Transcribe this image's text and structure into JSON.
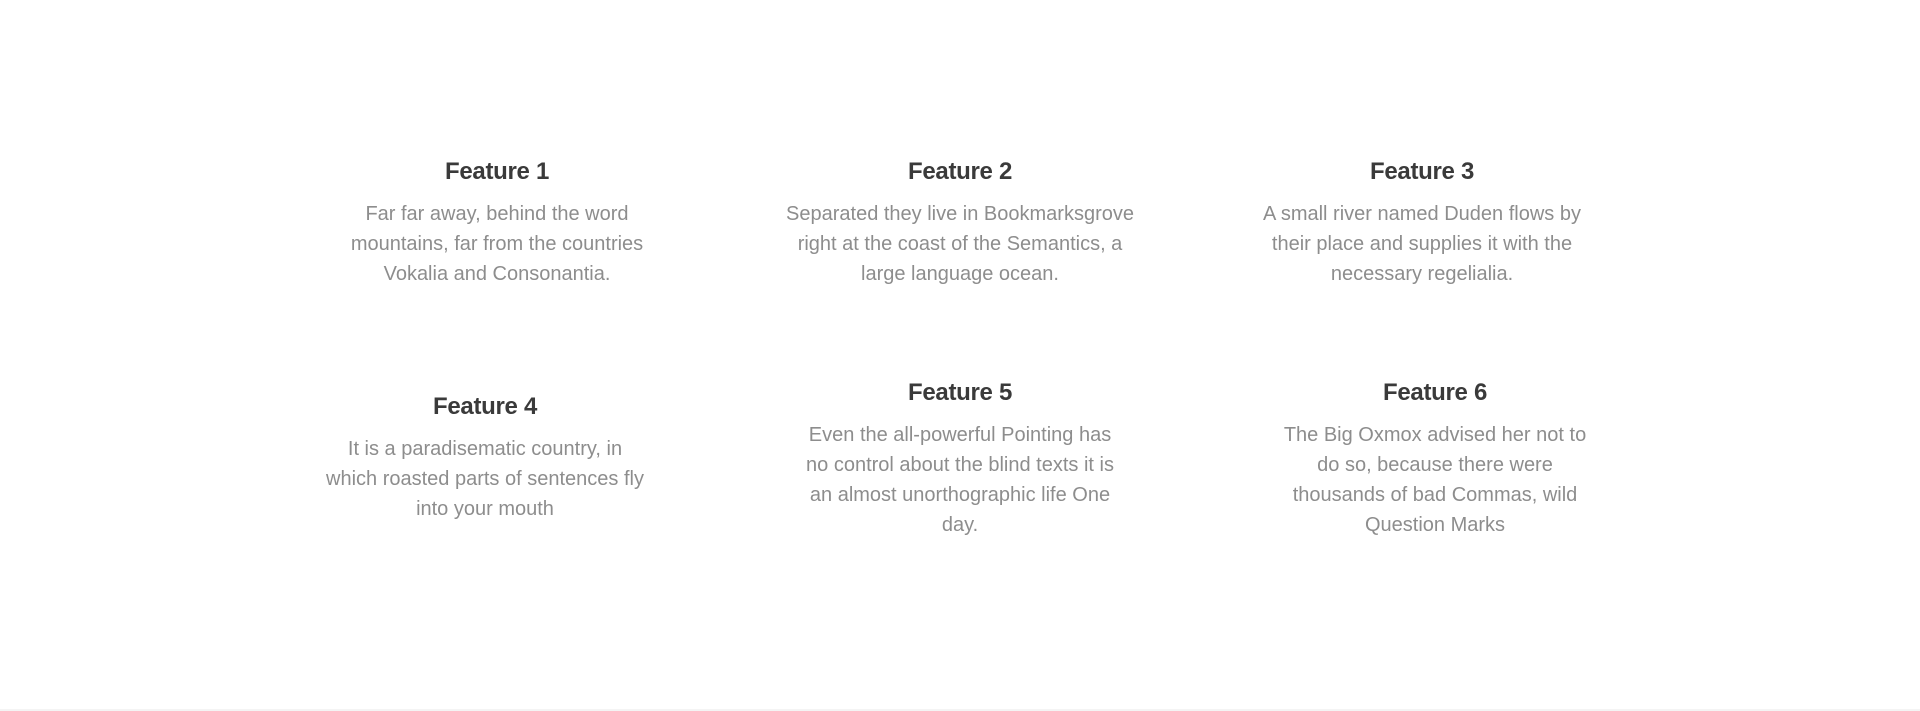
{
  "features": [
    {
      "title": "Feature 1",
      "text": "Far far away, behind the word mountains, far from the countries Vokalia and Consonantia."
    },
    {
      "title": "Feature 2",
      "text": "Separated they live in Bookmarksgrove right at the coast of the Semantics, a large language ocean."
    },
    {
      "title": "Feature 3",
      "text": "A small river named Duden flows by their place and supplies it with the necessary regelialia."
    },
    {
      "title": "Feature 4",
      "text": "It is a paradisematic country, in which roasted parts of sentences fly into your mouth"
    },
    {
      "title": "Feature 5",
      "text": "Even the all-powerful Pointing has no control about the blind texts it is an almost unorthographic life One day."
    },
    {
      "title": "Feature 6",
      "text": "The Big Oxmox advised her not to do so, because there were thousands of bad Commas, wild Question Marks"
    }
  ]
}
